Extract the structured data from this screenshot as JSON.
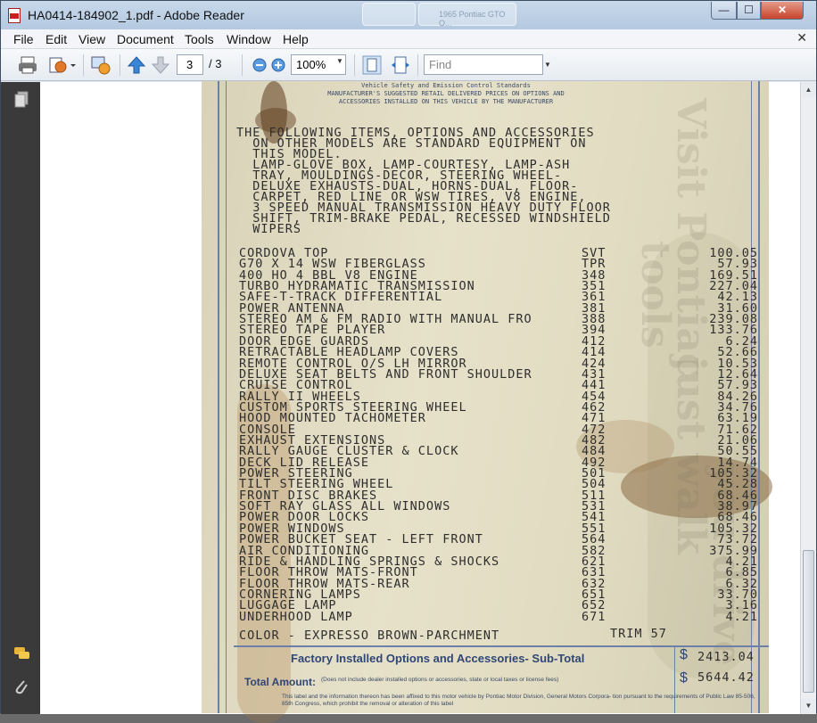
{
  "window": {
    "title": "HA0414-184902_1.pdf - Adobe Reader",
    "ghost_tabs": [
      "",
      "1965 Pontiac GTO O..."
    ],
    "controls": {
      "minimize": "—",
      "maximize": "☐",
      "close": "✕"
    }
  },
  "menu": {
    "items": [
      "File",
      "Edit",
      "View",
      "Document",
      "Tools",
      "Window",
      "Help"
    ],
    "close_glyph": "✕"
  },
  "toolbar": {
    "page_current": "3",
    "page_total": "/ 3",
    "zoom": "100%",
    "find_placeholder": "Find"
  },
  "sticker": {
    "header_lines": [
      "Vehicle Safety and Emission Control Standards",
      "MANUFACTURER'S SUGGESTED RETAIL DELIVERED PRICES ON OPTIONS AND",
      "ACCESSORIES INSTALLED ON THIS VEHICLE BY THE MANUFACTURER"
    ],
    "intro_lines": [
      "THE FOLLOWING ITEMS, OPTIONS AND ACCESSORIES",
      "  ON OTHER MODELS ARE STANDARD EQUIPMENT ON",
      "  THIS MODEL.",
      "  LAMP-GLOVE BOX, LAMP-COURTESY, LAMP-ASH",
      "  TRAY, MOULDINGS-DECOR, STEERING WHEEL-",
      "  DELUXE EXHAUSTS-DUAL, HORNS-DUAL, FLOOR-",
      "  CARPET, RED LINE OR WSW TIRES, V8 ENGINE,",
      "  3 SPEED MANUAL TRANSMISSION HEAVY DUTY FLOOR",
      "  SHIFT, TRIM-BRAKE PEDAL, RECESSED WINDSHIELD",
      "  WIPERS"
    ],
    "options": [
      {
        "name": "CORDOVA TOP",
        "code": "SVT",
        "price": "100.05"
      },
      {
        "name": "G70 X 14 WSW FIBERGLASS",
        "code": "TPR",
        "price": "57.93"
      },
      {
        "name": "400 HO 4 BBL V8 ENGINE",
        "code": "348",
        "price": "169.51"
      },
      {
        "name": "TURBO HYDRAMATIC TRANSMISSION",
        "code": "351",
        "price": "227.04"
      },
      {
        "name": "SAFE-T-TRACK DIFFERENTIAL",
        "code": "361",
        "price": "42.13"
      },
      {
        "name": "POWER ANTENNA",
        "code": "381",
        "price": "31.60"
      },
      {
        "name": "STEREO AM & FM RADIO WITH MANUAL FRO",
        "code": "388",
        "price": "239.08"
      },
      {
        "name": "STEREO TAPE PLAYER",
        "code": "394",
        "price": "133.76"
      },
      {
        "name": "DOOR EDGE GUARDS",
        "code": "412",
        "price": "6.24"
      },
      {
        "name": "RETRACTABLE HEADLAMP COVERS",
        "code": "414",
        "price": "52.66"
      },
      {
        "name": "REMOTE CONTROL O/S LH MIRROR",
        "code": "424",
        "price": "10.53"
      },
      {
        "name": "DELUXE SEAT BELTS AND FRONT SHOULDER",
        "code": "431",
        "price": "12.64"
      },
      {
        "name": "CRUISE CONTROL",
        "code": "441",
        "price": "57.93"
      },
      {
        "name": "RALLY II WHEELS",
        "code": "454",
        "price": "84.26"
      },
      {
        "name": "CUSTOM SPORTS STEERING WHEEL",
        "code": "462",
        "price": "34.76"
      },
      {
        "name": "HOOD MOUNTED TACHOMETER",
        "code": "471",
        "price": "63.19"
      },
      {
        "name": "CONSOLE",
        "code": "472",
        "price": "71.62"
      },
      {
        "name": "EXHAUST EXTENSIONS",
        "code": "482",
        "price": "21.06"
      },
      {
        "name": "RALLY GAUGE CLUSTER & CLOCK",
        "code": "484",
        "price": "50.55"
      },
      {
        "name": "DECK LID RELEASE",
        "code": "492",
        "price": "14.74"
      },
      {
        "name": "POWER STEERING",
        "code": "501",
        "price": "105.32"
      },
      {
        "name": "TILT STEERING WHEEL",
        "code": "504",
        "price": "45.28"
      },
      {
        "name": "FRONT DISC BRAKES",
        "code": "511",
        "price": "68.46"
      },
      {
        "name": "SOFT RAY GLASS ALL WINDOWS",
        "code": "531",
        "price": "38.97"
      },
      {
        "name": "POWER DOOR LOCKS",
        "code": "541",
        "price": "68.46"
      },
      {
        "name": "POWER WINDOWS",
        "code": "551",
        "price": "105.32"
      },
      {
        "name": "POWER BUCKET SEAT - LEFT FRONT",
        "code": "564",
        "price": "73.72"
      },
      {
        "name": "AIR CONDITIONING",
        "code": "582",
        "price": "375.99"
      },
      {
        "name": "RIDE & HANDLING SPRINGS & SHOCKS",
        "code": "621",
        "price": "4.21"
      },
      {
        "name": "FLOOR THROW MATS-FRONT",
        "code": "631",
        "price": "6.85"
      },
      {
        "name": "FLOOR THROW MATS-REAR",
        "code": "632",
        "price": "6.32"
      },
      {
        "name": "CORNERING LAMPS",
        "code": "651",
        "price": "33.70"
      },
      {
        "name": "LUGGAGE LAMP",
        "code": "652",
        "price": "3.16"
      },
      {
        "name": "UNDERHOOD LAMP",
        "code": "671",
        "price": "4.21"
      }
    ],
    "color": "COLOR - EXPRESSO BROWN-PARCHMENT",
    "trim": "TRIM 57",
    "subtotal_label": "Factory Installed Options and Accessories- Sub-Total",
    "subtotal_value": "2413.04",
    "total_label": "Total Amount:",
    "total_note": "(Does not include dealer installed options or accessories, state or local taxes or license fees)",
    "total_value": "5644.42",
    "dollar": "$",
    "fine_print": "This label and the information thereon has been affixed to this motor vehicle by Pontiac Motor Division, General Motors Corpora- tion pursuant to the requirements of Public Law 85-506, 85th Congress, which prohibit the removal or alteration of this label",
    "ghost_text": [
      "Visit Pontiac",
      "tools",
      "just walk",
      "you drive"
    ]
  }
}
